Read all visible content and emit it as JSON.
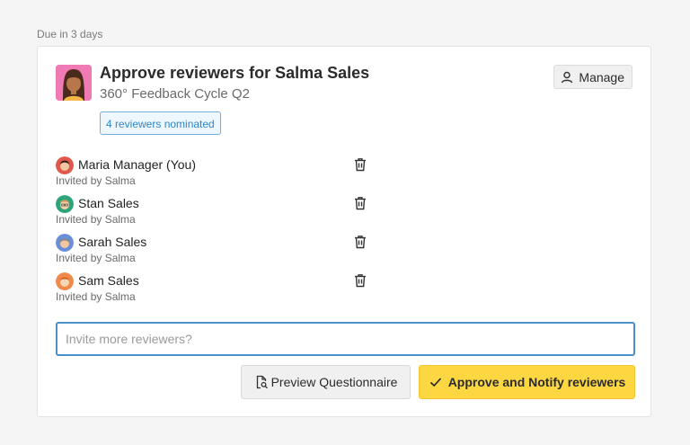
{
  "due_label": "Due in 3 days",
  "task": {
    "title": "Approve reviewers for Salma Sales",
    "subtitle": "360° Feedback Cycle Q2",
    "badge": "4 reviewers nominated",
    "manage_label": "Manage"
  },
  "reviewers": [
    {
      "name": "Maria Manager (You)",
      "invited_by": "Invited by Salma",
      "avatar_color": "#e2574c"
    },
    {
      "name": "Stan Sales",
      "invited_by": "Invited by Salma",
      "avatar_color": "#2ea37a"
    },
    {
      "name": "Sarah Sales",
      "invited_by": "Invited by Salma",
      "avatar_color": "#6a8fd8"
    },
    {
      "name": "Sam Sales",
      "invited_by": "Invited by Salma",
      "avatar_color": "#f08a4b"
    }
  ],
  "invite": {
    "placeholder": "Invite more reviewers?",
    "value": ""
  },
  "actions": {
    "preview_label": "Preview Questionnaire",
    "approve_label": "Approve and Notify reviewers"
  },
  "colors": {
    "accent": "#4a90c9",
    "approve": "#fcd742",
    "badge_text": "#2f86c8"
  },
  "icons": {
    "manage": "user-icon",
    "delete": "trash-icon",
    "preview": "document-search-icon",
    "approve": "check-icon"
  }
}
